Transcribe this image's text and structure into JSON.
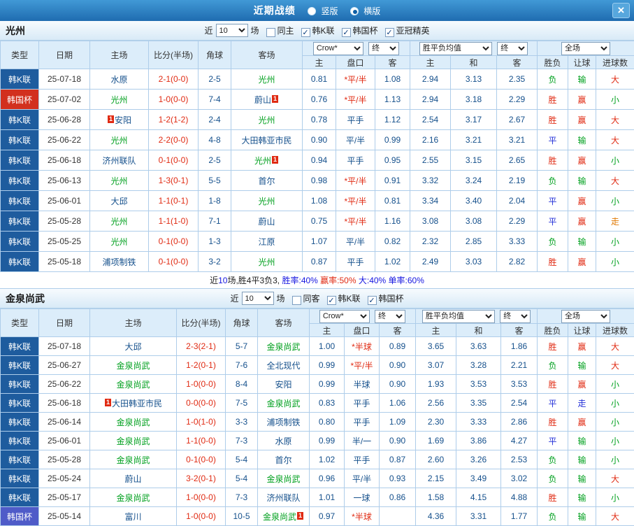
{
  "titlebar": {
    "title": "近期战绩",
    "radio_vertical": "竖版",
    "radio_horizontal": "横版",
    "selected_layout": "横版",
    "close_icon": "×"
  },
  "header_labels": {
    "type": "类型",
    "date": "日期",
    "home": "主场",
    "score": "比分(半场)",
    "corner": "角球",
    "away": "客场",
    "ah_home": "主",
    "ah_line": "盘口",
    "ah_away": "客",
    "eu_home": "主",
    "eu_draw": "和",
    "eu_away": "客",
    "res_wdl": "胜负",
    "res_handicap": "让球",
    "res_goals": "进球数"
  },
  "sections": [
    {
      "team": "光州",
      "near_label": "近",
      "near_value": "10",
      "games_label": "场",
      "checkboxes": [
        {
          "label": "同主",
          "checked": false
        },
        {
          "label": "韩K联",
          "checked": true
        },
        {
          "label": "韩国杯",
          "checked": true
        },
        {
          "label": "亚冠精英",
          "checked": true
        }
      ],
      "dropdowns": {
        "company": "Crow*",
        "final1": "终",
        "europe": "胜平负均值",
        "final2": "终",
        "scope": "全场"
      },
      "rows": [
        {
          "type": "韩K联",
          "style": "blue",
          "date": "25-07-18",
          "home": {
            "name": "水原"
          },
          "score": "2-1(0-0)",
          "corner": "2-5",
          "away": {
            "name": "光州",
            "focus": true
          },
          "ah": [
            "0.81",
            "*平/半",
            "1.08"
          ],
          "eu": [
            "2.94",
            "3.13",
            "2.35"
          ],
          "res": [
            "负",
            "输",
            "大"
          ]
        },
        {
          "type": "韩国杯",
          "style": "red",
          "date": "25-07-02",
          "home": {
            "name": "光州",
            "focus": true
          },
          "score": "1-0(0-0)",
          "corner": "7-4",
          "away": {
            "name": "蔚山",
            "badge": "1",
            "badge_pos": "after"
          },
          "ah": [
            "0.76",
            "*平/半",
            "1.13"
          ],
          "eu": [
            "2.94",
            "3.18",
            "2.29"
          ],
          "res": [
            "胜",
            "赢",
            "小"
          ]
        },
        {
          "type": "韩K联",
          "style": "blue",
          "date": "25-06-28",
          "home": {
            "name": "安阳",
            "badge": "1",
            "badge_pos": "before"
          },
          "score": "1-2(1-2)",
          "corner": "2-4",
          "away": {
            "name": "光州",
            "focus": true
          },
          "ah": [
            "0.78",
            "平手",
            "1.12"
          ],
          "eu": [
            "2.54",
            "3.17",
            "2.67"
          ],
          "res": [
            "胜",
            "赢",
            "大"
          ]
        },
        {
          "type": "韩K联",
          "style": "blue",
          "date": "25-06-22",
          "home": {
            "name": "光州",
            "focus": true
          },
          "score": "2-2(0-0)",
          "corner": "4-8",
          "away": {
            "name": "大田韩亚市民"
          },
          "ah": [
            "0.90",
            "平/半",
            "0.99"
          ],
          "eu": [
            "2.16",
            "3.21",
            "3.21"
          ],
          "res": [
            "平",
            "输",
            "大"
          ]
        },
        {
          "type": "韩K联",
          "style": "blue",
          "date": "25-06-18",
          "home": {
            "name": "济州联队"
          },
          "score": "0-1(0-0)",
          "corner": "2-5",
          "away": {
            "name": "光州",
            "focus": true,
            "badge": "1",
            "badge_pos": "after"
          },
          "ah": [
            "0.94",
            "平手",
            "0.95"
          ],
          "eu": [
            "2.55",
            "3.15",
            "2.65"
          ],
          "res": [
            "胜",
            "赢",
            "小"
          ]
        },
        {
          "type": "韩K联",
          "style": "blue",
          "date": "25-06-13",
          "home": {
            "name": "光州",
            "focus": true
          },
          "score": "1-3(0-1)",
          "corner": "5-5",
          "away": {
            "name": "首尔"
          },
          "ah": [
            "0.98",
            "*平/半",
            "0.91"
          ],
          "eu": [
            "3.32",
            "3.24",
            "2.19"
          ],
          "res": [
            "负",
            "输",
            "大"
          ]
        },
        {
          "type": "韩K联",
          "style": "blue",
          "date": "25-06-01",
          "home": {
            "name": "大邱"
          },
          "score": "1-1(0-1)",
          "corner": "1-8",
          "away": {
            "name": "光州",
            "focus": true
          },
          "ah": [
            "1.08",
            "*平/半",
            "0.81"
          ],
          "eu": [
            "3.34",
            "3.40",
            "2.04"
          ],
          "res": [
            "平",
            "赢",
            "小"
          ]
        },
        {
          "type": "韩K联",
          "style": "blue",
          "date": "25-05-28",
          "home": {
            "name": "光州",
            "focus": true
          },
          "score": "1-1(1-0)",
          "corner": "7-1",
          "away": {
            "name": "蔚山"
          },
          "ah": [
            "0.75",
            "*平/半",
            "1.16"
          ],
          "eu": [
            "3.08",
            "3.08",
            "2.29"
          ],
          "res": [
            "平",
            "赢",
            "走"
          ]
        },
        {
          "type": "韩K联",
          "style": "blue",
          "date": "25-05-25",
          "home": {
            "name": "光州",
            "focus": true
          },
          "score": "0-1(0-0)",
          "corner": "1-3",
          "away": {
            "name": "江原"
          },
          "ah": [
            "1.07",
            "平/半",
            "0.82"
          ],
          "eu": [
            "2.32",
            "2.85",
            "3.33"
          ],
          "res": [
            "负",
            "输",
            "小"
          ]
        },
        {
          "type": "韩K联",
          "style": "blue",
          "date": "25-05-18",
          "home": {
            "name": "浦项制铁"
          },
          "score": "0-1(0-0)",
          "corner": "3-2",
          "away": {
            "name": "光州",
            "focus": true
          },
          "ah": [
            "0.87",
            "平手",
            "1.02"
          ],
          "eu": [
            "2.49",
            "3.03",
            "2.82"
          ],
          "res": [
            "胜",
            "赢",
            "小"
          ]
        }
      ],
      "summary": [
        {
          "t": "近",
          "c": "dark"
        },
        {
          "t": "10",
          "c": "blue"
        },
        {
          "t": "场,胜4平3负3, ",
          "c": "dark"
        },
        {
          "t": "胜率:40%",
          "c": "blue"
        },
        {
          "t": " 赢率:50%",
          "c": "red"
        },
        {
          "t": " 大:40%",
          "c": "blue"
        },
        {
          "t": " 单率:60%",
          "c": "blue"
        }
      ]
    },
    {
      "team": "金泉尚武",
      "near_label": "近",
      "near_value": "10",
      "games_label": "场",
      "checkboxes": [
        {
          "label": "同客",
          "checked": false
        },
        {
          "label": "韩K联",
          "checked": true
        },
        {
          "label": "韩国杯",
          "checked": true
        }
      ],
      "dropdowns": {
        "company": "Crow*",
        "final1": "终",
        "europe": "胜平负均值",
        "final2": "终",
        "scope": "全场"
      },
      "rows": [
        {
          "type": "韩K联",
          "style": "blue",
          "date": "25-07-18",
          "home": {
            "name": "大邱"
          },
          "score": "2-3(2-1)",
          "corner": "5-7",
          "away": {
            "name": "金泉尚武",
            "focus": true
          },
          "ah": [
            "1.00",
            "*半球",
            "0.89"
          ],
          "eu": [
            "3.65",
            "3.63",
            "1.86"
          ],
          "res": [
            "胜",
            "赢",
            "大"
          ]
        },
        {
          "type": "韩K联",
          "style": "blue",
          "date": "25-06-27",
          "home": {
            "name": "金泉尚武",
            "focus": true
          },
          "score": "1-2(0-1)",
          "corner": "7-6",
          "away": {
            "name": "全北现代"
          },
          "ah": [
            "0.99",
            "*平/半",
            "0.90"
          ],
          "eu": [
            "3.07",
            "3.28",
            "2.21"
          ],
          "res": [
            "负",
            "输",
            "大"
          ]
        },
        {
          "type": "韩K联",
          "style": "blue",
          "date": "25-06-22",
          "home": {
            "name": "金泉尚武",
            "focus": true
          },
          "score": "1-0(0-0)",
          "corner": "8-4",
          "away": {
            "name": "安阳"
          },
          "ah": [
            "0.99",
            "半球",
            "0.90"
          ],
          "eu": [
            "1.93",
            "3.53",
            "3.53"
          ],
          "res": [
            "胜",
            "赢",
            "小"
          ]
        },
        {
          "type": "韩K联",
          "style": "blue",
          "date": "25-06-18",
          "home": {
            "name": "大田韩亚市民",
            "badge": "1",
            "badge_pos": "before"
          },
          "score": "0-0(0-0)",
          "corner": "7-5",
          "away": {
            "name": "金泉尚武",
            "focus": true
          },
          "ah": [
            "0.83",
            "平手",
            "1.06"
          ],
          "eu": [
            "2.56",
            "3.35",
            "2.54"
          ],
          "res": [
            "平",
            "走",
            "小"
          ]
        },
        {
          "type": "韩K联",
          "style": "blue",
          "date": "25-06-14",
          "home": {
            "name": "金泉尚武",
            "focus": true
          },
          "score": "1-0(1-0)",
          "corner": "3-3",
          "away": {
            "name": "浦项制铁"
          },
          "ah": [
            "0.80",
            "平手",
            "1.09"
          ],
          "eu": [
            "2.30",
            "3.33",
            "2.86"
          ],
          "res": [
            "胜",
            "赢",
            "小"
          ]
        },
        {
          "type": "韩K联",
          "style": "blue",
          "date": "25-06-01",
          "home": {
            "name": "金泉尚武",
            "focus": true
          },
          "score": "1-1(0-0)",
          "corner": "7-3",
          "away": {
            "name": "水原"
          },
          "ah": [
            "0.99",
            "半/一",
            "0.90"
          ],
          "eu": [
            "1.69",
            "3.86",
            "4.27"
          ],
          "res": [
            "平",
            "输",
            "小"
          ]
        },
        {
          "type": "韩K联",
          "style": "blue",
          "date": "25-05-28",
          "home": {
            "name": "金泉尚武",
            "focus": true
          },
          "score": "0-1(0-0)",
          "corner": "5-4",
          "away": {
            "name": "首尔"
          },
          "ah": [
            "1.02",
            "平手",
            "0.87"
          ],
          "eu": [
            "2.60",
            "3.26",
            "2.53"
          ],
          "res": [
            "负",
            "输",
            "小"
          ]
        },
        {
          "type": "韩K联",
          "style": "blue",
          "date": "25-05-24",
          "home": {
            "name": "蔚山"
          },
          "score": "3-2(0-1)",
          "corner": "5-4",
          "away": {
            "name": "金泉尚武",
            "focus": true
          },
          "ah": [
            "0.96",
            "平/半",
            "0.93"
          ],
          "eu": [
            "2.15",
            "3.49",
            "3.02"
          ],
          "res": [
            "负",
            "输",
            "大"
          ]
        },
        {
          "type": "韩K联",
          "style": "blue",
          "date": "25-05-17",
          "home": {
            "name": "金泉尚武",
            "focus": true
          },
          "score": "1-0(0-0)",
          "corner": "7-3",
          "away": {
            "name": "济州联队"
          },
          "ah": [
            "1.01",
            "一球",
            "0.86"
          ],
          "eu": [
            "1.58",
            "4.15",
            "4.88"
          ],
          "res": [
            "胜",
            "输",
            "小"
          ]
        },
        {
          "type": "韩国杯",
          "style": "indigo",
          "date": "25-05-14",
          "home": {
            "name": "富川"
          },
          "score": "1-0(0-0)",
          "corner": "10-5",
          "away": {
            "name": "金泉尚武",
            "focus": true,
            "badge": "1",
            "badge_pos": "after"
          },
          "ah": [
            "0.97",
            "*半球",
            ""
          ],
          "eu": [
            "4.36",
            "3.31",
            "1.77"
          ],
          "res": [
            "负",
            "输",
            "大"
          ]
        }
      ]
    }
  ]
}
